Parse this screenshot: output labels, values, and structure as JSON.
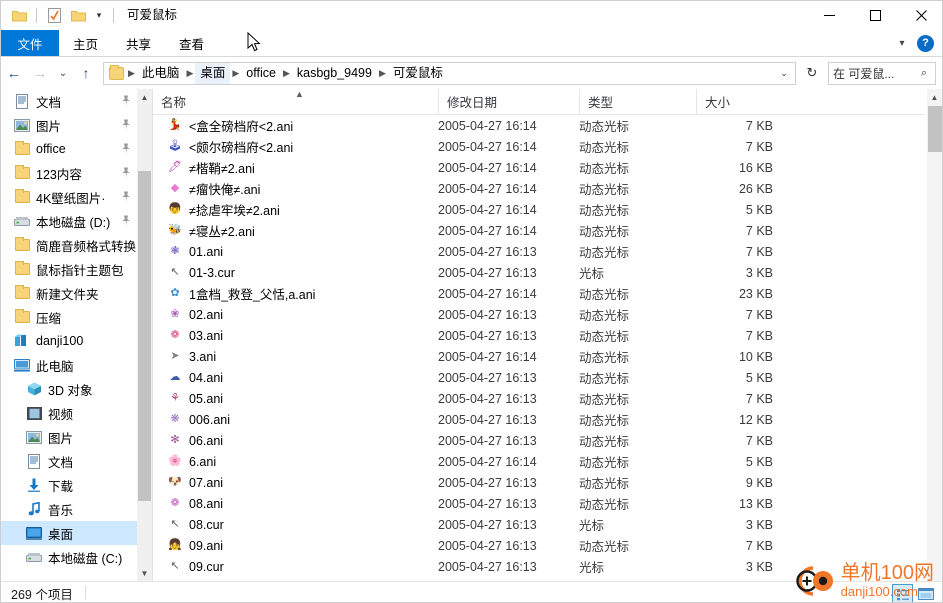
{
  "window": {
    "title": "可爱鼠标",
    "quick_access": [
      "folder-icon",
      "properties-icon",
      "new-folder-icon",
      "customize-caret-icon"
    ],
    "controls": {
      "minimize": "—",
      "maximize": "☐",
      "close": "✕"
    }
  },
  "ribbon": {
    "tabs": [
      {
        "label": "文件",
        "active": true
      },
      {
        "label": "主页",
        "active": false
      },
      {
        "label": "共享",
        "active": false
      },
      {
        "label": "查看",
        "active": false
      }
    ],
    "collapse_icon": "chevron-down-icon",
    "help_label": "?"
  },
  "addressbar": {
    "back_icon": "←",
    "forward_icon": "→",
    "history_icon": "⌄",
    "up_icon": "↑",
    "crumbs": [
      {
        "label": "此电脑",
        "selected": false
      },
      {
        "label": "桌面",
        "selected": true
      },
      {
        "label": "office",
        "selected": false
      },
      {
        "label": "kasbgb_9499",
        "selected": false
      },
      {
        "label": "可爱鼠标",
        "selected": false
      }
    ],
    "dropdown_icon": "⌄",
    "refresh_icon": "↻",
    "search_value": "在 可爱鼠...",
    "search_icon": "⌕"
  },
  "navpane": {
    "items": [
      {
        "label": "文档",
        "icon": "documents-icon",
        "pinned": true,
        "indent": 0,
        "selected": false
      },
      {
        "label": "图片",
        "icon": "pictures-icon",
        "pinned": true,
        "indent": 0,
        "selected": false
      },
      {
        "label": "office",
        "icon": "folder-icon",
        "pinned": true,
        "indent": 0,
        "selected": false
      },
      {
        "label": "123内容",
        "icon": "folder-icon",
        "pinned": true,
        "indent": 0,
        "selected": false
      },
      {
        "label": "4K壁纸图片·",
        "icon": "folder-icon",
        "pinned": true,
        "indent": 0,
        "selected": false
      },
      {
        "label": "本地磁盘 (D:)",
        "icon": "drive-icon",
        "pinned": true,
        "indent": 0,
        "selected": false
      },
      {
        "label": "简鹿音频格式转换",
        "icon": "folder-icon",
        "pinned": false,
        "indent": 0,
        "selected": false
      },
      {
        "label": "鼠标指针主题包",
        "icon": "folder-icon",
        "pinned": false,
        "indent": 0,
        "selected": false
      },
      {
        "label": "新建文件夹",
        "icon": "folder-icon",
        "pinned": false,
        "indent": 0,
        "selected": false
      },
      {
        "label": "压缩",
        "icon": "folder-icon",
        "pinned": false,
        "indent": 0,
        "selected": false
      },
      {
        "label": "danji100",
        "icon": "onedrive-icon",
        "pinned": false,
        "indent": 0,
        "selected": false
      },
      {
        "label": "此电脑",
        "icon": "this-pc-icon",
        "pinned": false,
        "indent": 0,
        "selected": false
      },
      {
        "label": "3D 对象",
        "icon": "3d-objects-icon",
        "pinned": false,
        "indent": 1,
        "selected": false
      },
      {
        "label": "视频",
        "icon": "videos-icon",
        "pinned": false,
        "indent": 1,
        "selected": false
      },
      {
        "label": "图片",
        "icon": "pictures-icon",
        "pinned": false,
        "indent": 1,
        "selected": false
      },
      {
        "label": "文档",
        "icon": "documents-icon",
        "pinned": false,
        "indent": 1,
        "selected": false
      },
      {
        "label": "下载",
        "icon": "downloads-icon",
        "pinned": false,
        "indent": 1,
        "selected": false
      },
      {
        "label": "音乐",
        "icon": "music-icon",
        "pinned": false,
        "indent": 1,
        "selected": false
      },
      {
        "label": "桌面",
        "icon": "desktop-icon",
        "pinned": false,
        "indent": 1,
        "selected": true
      },
      {
        "label": "本地磁盘 (C:)",
        "icon": "drive-icon",
        "pinned": false,
        "indent": 1,
        "selected": false
      }
    ]
  },
  "filelist": {
    "columns": [
      {
        "label": "名称",
        "key": "name"
      },
      {
        "label": "修改日期",
        "key": "date"
      },
      {
        "label": "类型",
        "key": "type"
      },
      {
        "label": "大小",
        "key": "size"
      }
    ],
    "sort": {
      "column": "名称",
      "direction": "ascending",
      "indicator": "▲"
    },
    "rows": [
      {
        "name": "<盒全磅档府<2.ani",
        "date": "2005-04-27 16:14",
        "type": "动态光标",
        "size": "7 KB",
        "icon": "💃",
        "color": "#e0348c"
      },
      {
        "name": "<颇尔磅档府<2.ani",
        "date": "2005-04-27 16:14",
        "type": "动态光标",
        "size": "7 KB",
        "icon": "🕹",
        "color": "#3a4fc0"
      },
      {
        "name": "≠楷鞘≠2.ani",
        "date": "2005-04-27 16:14",
        "type": "动态光标",
        "size": "16 KB",
        "icon": "🖊",
        "color": "#c23fa8"
      },
      {
        "name": "≠瘤快俺≠.ani",
        "date": "2005-04-27 16:14",
        "type": "动态光标",
        "size": "26 KB",
        "icon": "◆",
        "color": "#ea7ad0"
      },
      {
        "name": "≠捻虐牢埃≠2.ani",
        "date": "2005-04-27 16:14",
        "type": "动态光标",
        "size": "5 KB",
        "icon": "👦",
        "color": "#e8a020"
      },
      {
        "name": "≠寝丛≠2.ani",
        "date": "2005-04-27 16:14",
        "type": "动态光标",
        "size": "7 KB",
        "icon": "🐝",
        "color": "#d4a017"
      },
      {
        "name": "01.ani",
        "date": "2005-04-27 16:13",
        "type": "动态光标",
        "size": "7 KB",
        "icon": "❃",
        "color": "#7b5ec0"
      },
      {
        "name": "01-3.cur",
        "date": "2005-04-27 16:13",
        "type": "光标",
        "size": "3 KB",
        "icon": "↖",
        "color": "#606060"
      },
      {
        "name": "1盒档_救登_父恬,a.ani",
        "date": "2005-04-27 16:14",
        "type": "动态光标",
        "size": "23 KB",
        "icon": "✿",
        "color": "#3e8ed0"
      },
      {
        "name": "02.ani",
        "date": "2005-04-27 16:13",
        "type": "动态光标",
        "size": "7 KB",
        "icon": "❀",
        "color": "#b05cc0"
      },
      {
        "name": "03.ani",
        "date": "2005-04-27 16:13",
        "type": "动态光标",
        "size": "7 KB",
        "icon": "❁",
        "color": "#d94a8a"
      },
      {
        "name": "3.ani",
        "date": "2005-04-27 16:14",
        "type": "动态光标",
        "size": "10 KB",
        "icon": "➤",
        "color": "#808080"
      },
      {
        "name": "04.ani",
        "date": "2005-04-27 16:13",
        "type": "动态光标",
        "size": "5 KB",
        "icon": "☁",
        "color": "#3c5aa6"
      },
      {
        "name": "05.ani",
        "date": "2005-04-27 16:13",
        "type": "动态光标",
        "size": "7 KB",
        "icon": "⚘",
        "color": "#b0407a"
      },
      {
        "name": "006.ani",
        "date": "2005-04-27 16:13",
        "type": "动态光标",
        "size": "12 KB",
        "icon": "❋",
        "color": "#9a6fc0"
      },
      {
        "name": "06.ani",
        "date": "2005-04-27 16:13",
        "type": "动态光标",
        "size": "7 KB",
        "icon": "✻",
        "color": "#a05090"
      },
      {
        "name": "6.ani",
        "date": "2005-04-27 16:14",
        "type": "动态光标",
        "size": "5 KB",
        "icon": "🌸",
        "color": "#e05ca0"
      },
      {
        "name": "07.ani",
        "date": "2005-04-27 16:13",
        "type": "动态光标",
        "size": "9 KB",
        "icon": "🐶",
        "color": "#c08040"
      },
      {
        "name": "08.ani",
        "date": "2005-04-27 16:13",
        "type": "动态光标",
        "size": "13 KB",
        "icon": "❁",
        "color": "#c060c0"
      },
      {
        "name": "08.cur",
        "date": "2005-04-27 16:13",
        "type": "光标",
        "size": "3 KB",
        "icon": "↖",
        "color": "#606060"
      },
      {
        "name": "09.ani",
        "date": "2005-04-27 16:13",
        "type": "动态光标",
        "size": "7 KB",
        "icon": "👧",
        "color": "#8b4a2b"
      },
      {
        "name": "09.cur",
        "date": "2005-04-27 16:13",
        "type": "光标",
        "size": "3 KB",
        "icon": "↖",
        "color": "#606060"
      }
    ]
  },
  "statusbar": {
    "item_count": "269 个项目",
    "view_details_icon": "details-view-icon",
    "view_large_icon": "large-icons-view-icon"
  },
  "watermark": {
    "title": "单机100网",
    "subtitle": "danji100.com",
    "color": "#f2762a"
  }
}
